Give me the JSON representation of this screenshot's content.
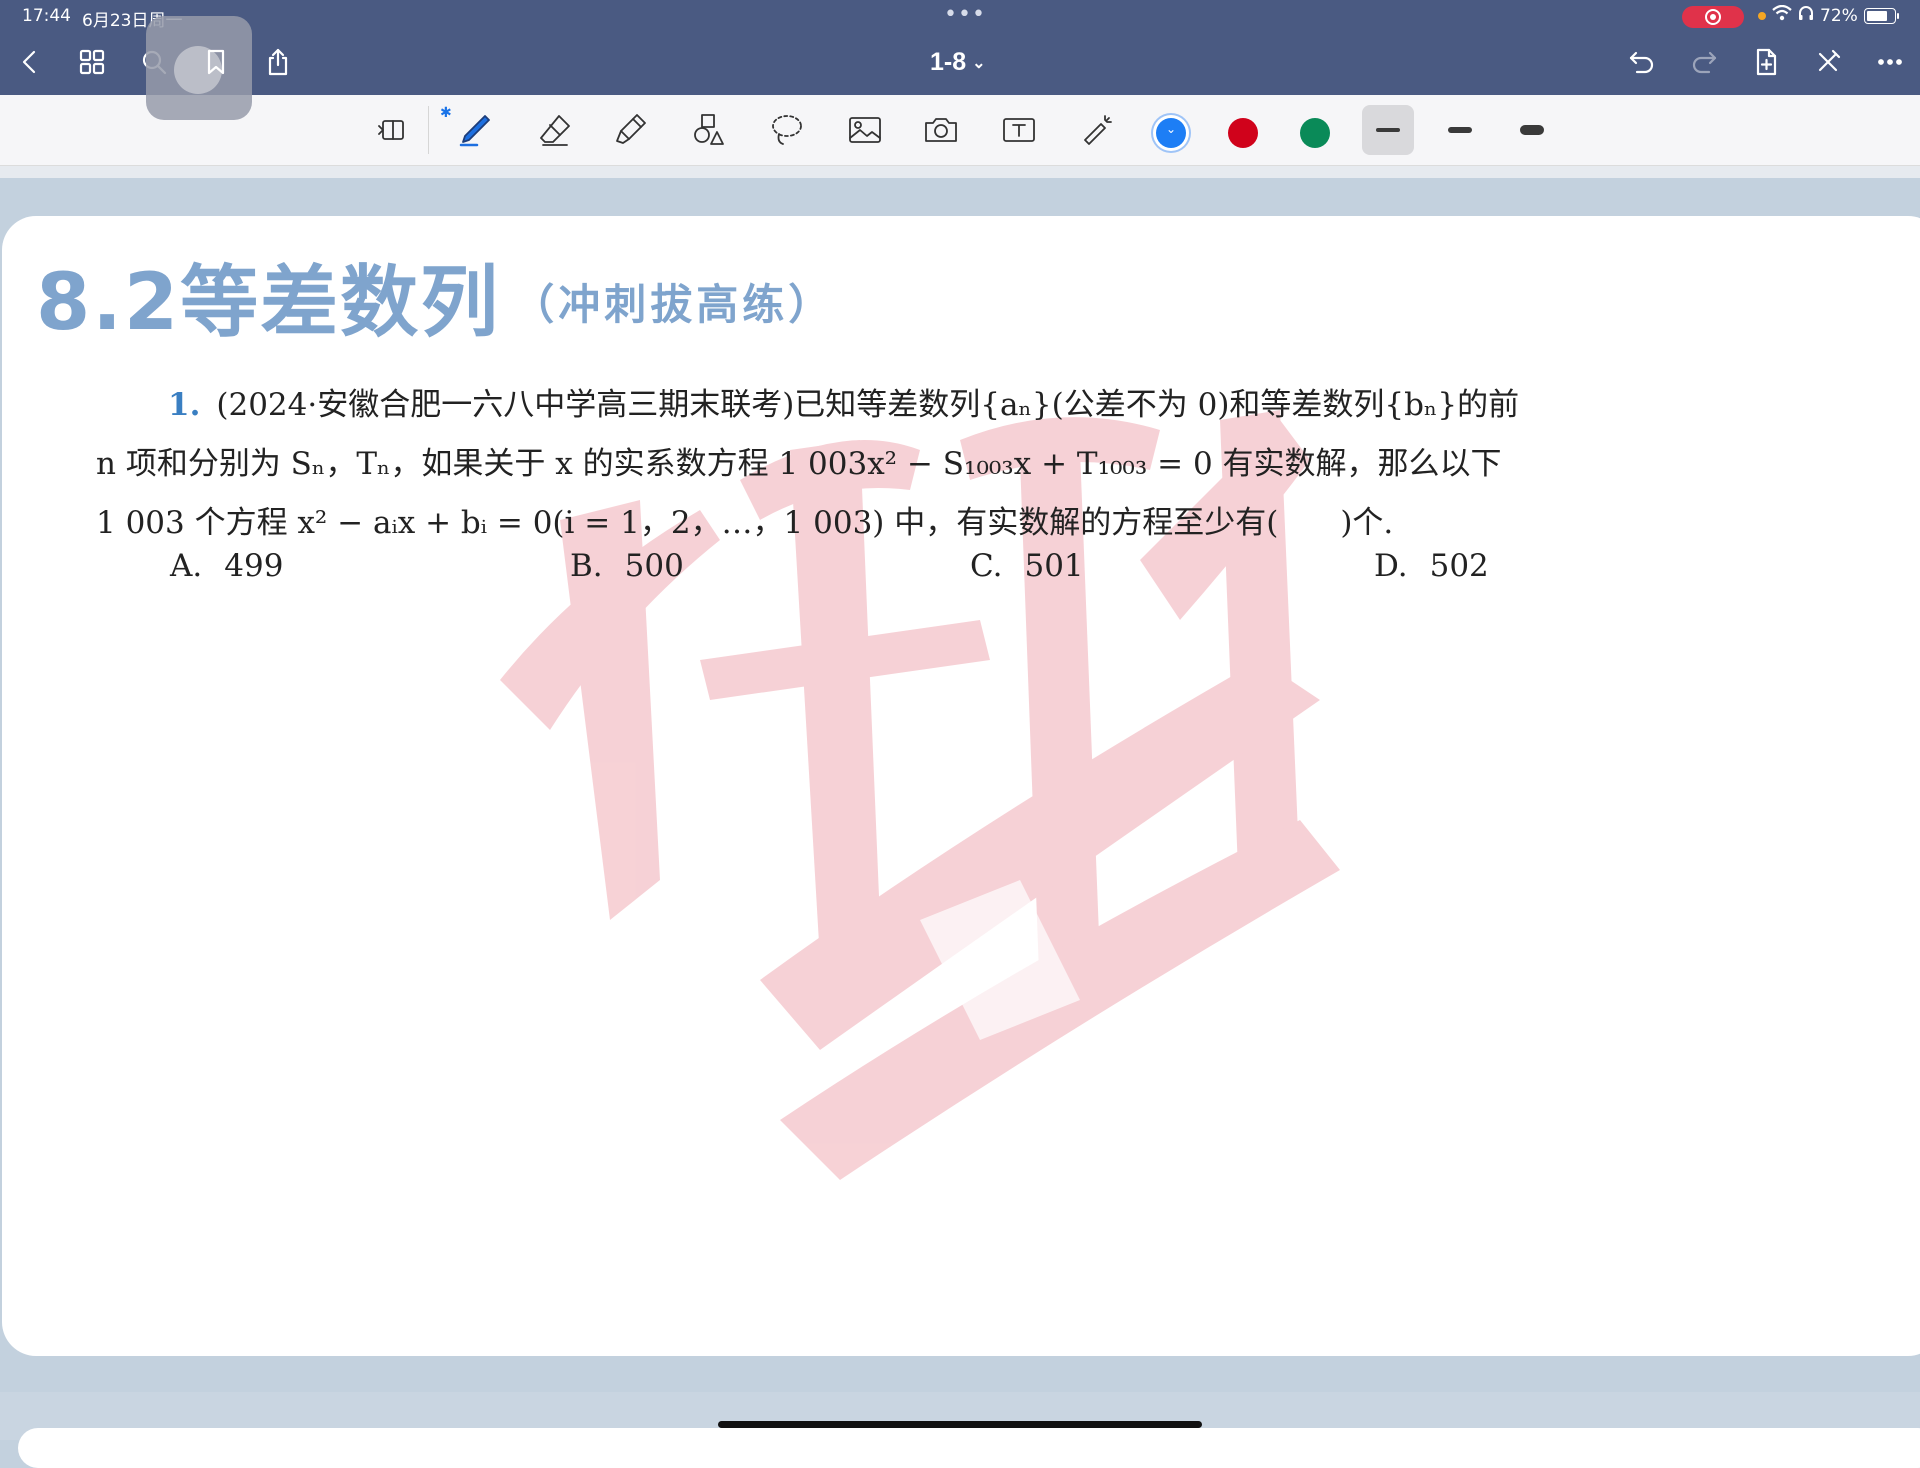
{
  "status_bar": {
    "time": "17:44",
    "date": "6月23日周一",
    "battery": "72%"
  },
  "nav": {
    "page_indicator": "1-8",
    "icons": [
      "back-icon",
      "grid-icon",
      "search-icon",
      "bookmark-icon",
      "share-icon",
      "undo-icon",
      "redo-icon",
      "add-page-icon",
      "close-icon",
      "more-icon"
    ]
  },
  "toolbar": {
    "tools": [
      "read-mode-icon",
      "pen-icon",
      "eraser-icon",
      "highlighter-icon",
      "shapes-icon",
      "lasso-icon",
      "image-icon",
      "camera-icon",
      "text-box-icon",
      "laser-pointer-icon"
    ],
    "colors": [
      "#1d7ef5",
      "#d0021b",
      "#0a8a58"
    ],
    "selected_color": "#1d7ef5",
    "stroke_options": [
      "thin",
      "medium",
      "thick"
    ],
    "selected_stroke": "thin"
  },
  "document": {
    "section_title": "8.2等差数列",
    "section_subtitle": "（冲刺拔高练）",
    "question": {
      "number": "1.",
      "line1": "(2024·安徽合肥一六八中学高三期末联考)已知等差数列{aₙ}(公差不为 0)和等差数列{bₙ}的前",
      "line2": "n 项和分别为 Sₙ，Tₙ，如果关于 x 的实系数方程 1 003x² − S₁₀₀₃x + T₁₀₀₃ = 0 有实数解，那么以下",
      "line3": "1 003 个方程 x² − aᵢx + bᵢ = 0(i = 1，2，…，1 003) 中，有实数解的方程至少有(　　)个."
    },
    "options": [
      {
        "label": "A.",
        "value": "499"
      },
      {
        "label": "B.",
        "value": "500"
      },
      {
        "label": "C.",
        "value": "501"
      },
      {
        "label": "D.",
        "value": "502"
      }
    ]
  },
  "colors": {
    "nav_bg": "#4a5a82",
    "title_blue": "#7fa4cd",
    "question_number": "#3a7fc2",
    "watermark": "#f6cdd2"
  }
}
